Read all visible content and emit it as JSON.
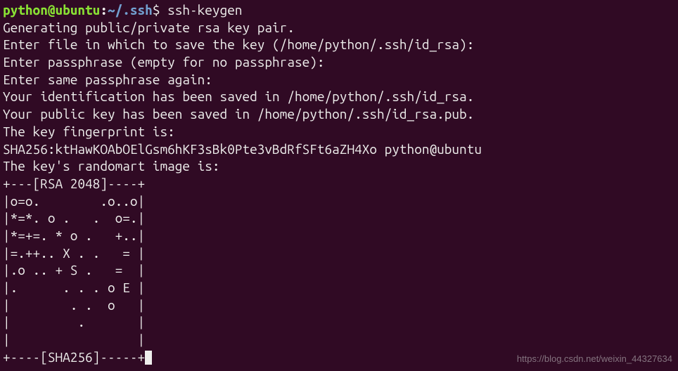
{
  "prompt": {
    "user_host": "python@ubuntu",
    "separator": ":",
    "path": "~/.ssh",
    "symbol": "$",
    "command": "ssh-keygen"
  },
  "output": {
    "lines": [
      "Generating public/private rsa key pair.",
      "Enter file in which to save the key (/home/python/.ssh/id_rsa):",
      "Enter passphrase (empty for no passphrase):",
      "Enter same passphrase again:",
      "Your identification has been saved in /home/python/.ssh/id_rsa.",
      "Your public key has been saved in /home/python/.ssh/id_rsa.pub.",
      "The key fingerprint is:",
      "SHA256:ktHawKOAbOElGsm6hKF3sBk0Pte3vBdRfSFt6aZH4Xo python@ubuntu",
      "The key's randomart image is:",
      "+---[RSA 2048]----+",
      "|o=o.        .o..o|",
      "|*=*. o .   .  o=.|",
      "|*=+=. * o .   +..|",
      "|=.++.. X . .   = |",
      "|.o .. + S .   =  |",
      "|.      . . . o E |",
      "|        . .  o   |",
      "|         .       |",
      "|                 |",
      "+----[SHA256]-----+"
    ]
  },
  "watermark": "https://blog.csdn.net/weixin_44327634"
}
